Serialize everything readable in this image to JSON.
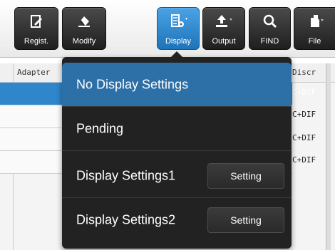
{
  "toolbar": {
    "buttons": [
      {
        "label": "Regist.",
        "icon": "pencil-icon"
      },
      {
        "label": "Modify",
        "icon": "eraser-icon"
      },
      {
        "label": "Display",
        "icon": "display-settings-icon"
      },
      {
        "label": "Output",
        "icon": "upload-icon"
      },
      {
        "label": "FIND",
        "icon": "search-icon"
      },
      {
        "label": "File",
        "icon": "file-icon"
      }
    ]
  },
  "grid": {
    "headers": {
      "adapter": "Adapter",
      "discr": "Discr"
    },
    "right_cells": [
      "C+DIF",
      "C+DIF",
      "C+DIF",
      "C+DIF"
    ]
  },
  "menu": {
    "items": [
      {
        "label": "No Display Settings"
      },
      {
        "label": "Pending"
      },
      {
        "label": "Display Settings1",
        "button": "Setting"
      },
      {
        "label": "Display Settings2",
        "button": "Setting"
      }
    ]
  },
  "colors": {
    "accent": "#2d6fa7",
    "menu_bg": "#222222",
    "toolbar_btn": "#2b2b2b"
  }
}
